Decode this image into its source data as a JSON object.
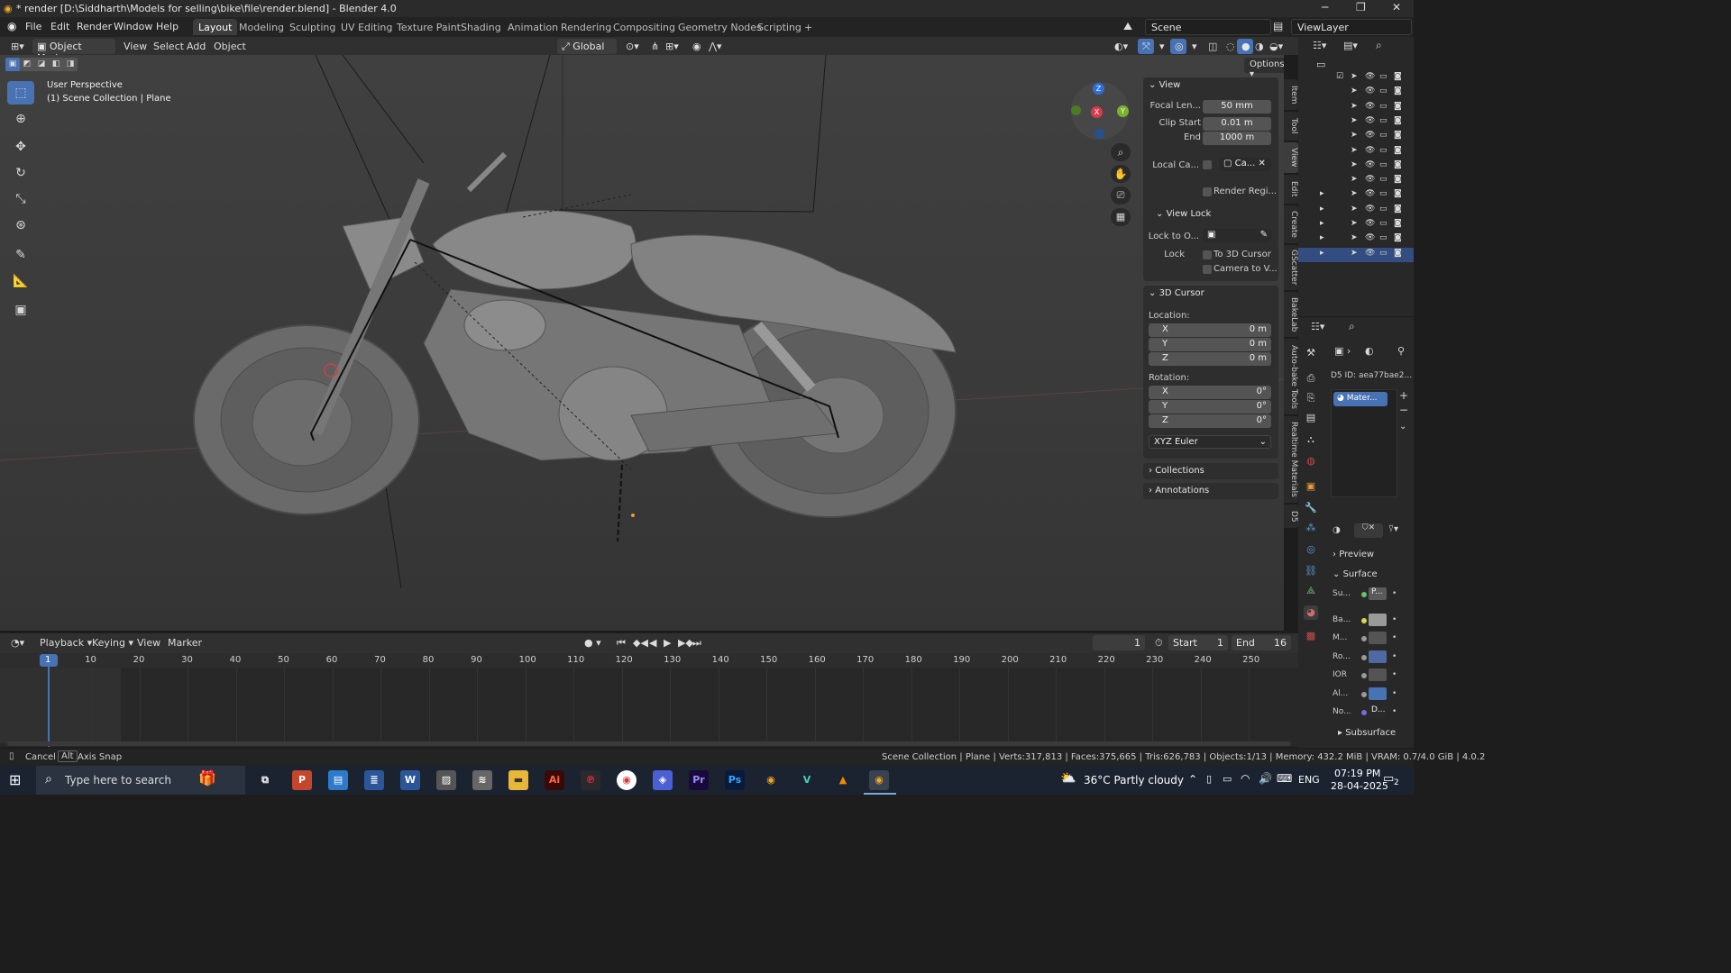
{
  "window": {
    "title": "* render [D:\\Siddharth\\Models for selling\\bike\\file\\render.blend] - Blender 4.0"
  },
  "menu": [
    "File",
    "Edit",
    "Render",
    "Window",
    "Help"
  ],
  "workspaces": [
    "Layout",
    "Modeling",
    "Sculpting",
    "UV Editing",
    "Texture Paint",
    "Shading",
    "Animation",
    "Rendering",
    "Compositing",
    "Geometry Nodes",
    "Scripting"
  ],
  "active_workspace": "Layout",
  "scene": "Scene",
  "view_layer": "ViewLayer",
  "viewport_header": {
    "mode": "Object Mode",
    "menus": [
      "View",
      "Select",
      "Add",
      "Object"
    ],
    "orientation": "Global",
    "options": "Options"
  },
  "viewport": {
    "perspective": "User Perspective",
    "collection": "(1) Scene Collection | Plane",
    "gizmo": {
      "x": "X",
      "y": "Y",
      "z": "Z"
    }
  },
  "npanel": {
    "view_header": "View",
    "focal_length_label": "Focal Len...",
    "focal_length": "50 mm",
    "clip_start_label": "Clip Start",
    "clip_start": "0.01 m",
    "clip_end_label": "End",
    "clip_end": "1000 m",
    "local_camera_label": "Local Ca...",
    "local_camera_value": "Ca...",
    "render_region": "Render Regi...",
    "view_lock_header": "View Lock",
    "lock_to_object_label": "Lock to O...",
    "lock_label": "Lock",
    "lock_cursor": "To 3D Cursor",
    "lock_camera": "Camera to V...",
    "cursor_header": "3D Cursor",
    "location_label": "Location:",
    "loc_x_label": "X",
    "loc_x": "0 m",
    "loc_y_label": "Y",
    "loc_y": "0 m",
    "loc_z_label": "Z",
    "loc_z": "0 m",
    "rotation_label": "Rotation:",
    "rot_x_label": "X",
    "rot_x": "0°",
    "rot_y_label": "Y",
    "rot_y": "0°",
    "rot_z_label": "Z",
    "rot_z": "0°",
    "rotation_mode": "XYZ Euler",
    "collections": "Collections",
    "annotations": "Annotations"
  },
  "vtabs": [
    "Item",
    "Tool",
    "View",
    "Edit",
    "Create",
    "GScatter",
    "BakeLab",
    "Auto-bake Tools",
    "Realtime Materials",
    "D5"
  ],
  "properties": {
    "d5_id": "D5 ID: aea77bae2...",
    "material": "Mater...",
    "preview": "Preview",
    "surface": "Surface",
    "rows": [
      {
        "label": "Su...",
        "value": "P..."
      },
      {
        "label": "Ba...",
        "value": ""
      },
      {
        "label": "M...",
        "value": ""
      },
      {
        "label": "Ro...",
        "value": ""
      },
      {
        "label": "IOR",
        "value": ""
      },
      {
        "label": "Al...",
        "value": ""
      },
      {
        "label": "No...",
        "value": "D..."
      }
    ],
    "subsurface": "Subsurface"
  },
  "timeline_header": {
    "menus": [
      "Playback",
      "Keying",
      "View",
      "Marker"
    ],
    "current_frame": "1",
    "start_label": "Start",
    "start": "1",
    "end_label": "End",
    "end": "16"
  },
  "timeline_ticks": [
    "1",
    "10",
    "20",
    "30",
    "40",
    "50",
    "60",
    "70",
    "80",
    "90",
    "100",
    "110",
    "120",
    "130",
    "140",
    "150",
    "160",
    "170",
    "180",
    "190",
    "200",
    "210",
    "220",
    "230",
    "240",
    "250"
  ],
  "status": {
    "cancel": "Cancel",
    "alt": "Alt",
    "axis_snap": "Axis Snap",
    "info": "Scene Collection | Plane | Verts:317,813 | Faces:375,665 | Tris:626,783 | Objects:1/13 | Memory: 432.2 MiB | VRAM: 0.7/4.0 GiB | 4.0.2"
  },
  "taskbar": {
    "search_placeholder": "Type here to search",
    "weather": "36°C  Partly cloudy",
    "lang": "ENG",
    "time": "07:19 PM",
    "date": "28-04-2025",
    "notif": "2"
  },
  "colors": {
    "accent": "#4772b3",
    "selected_row": "#334d80"
  }
}
